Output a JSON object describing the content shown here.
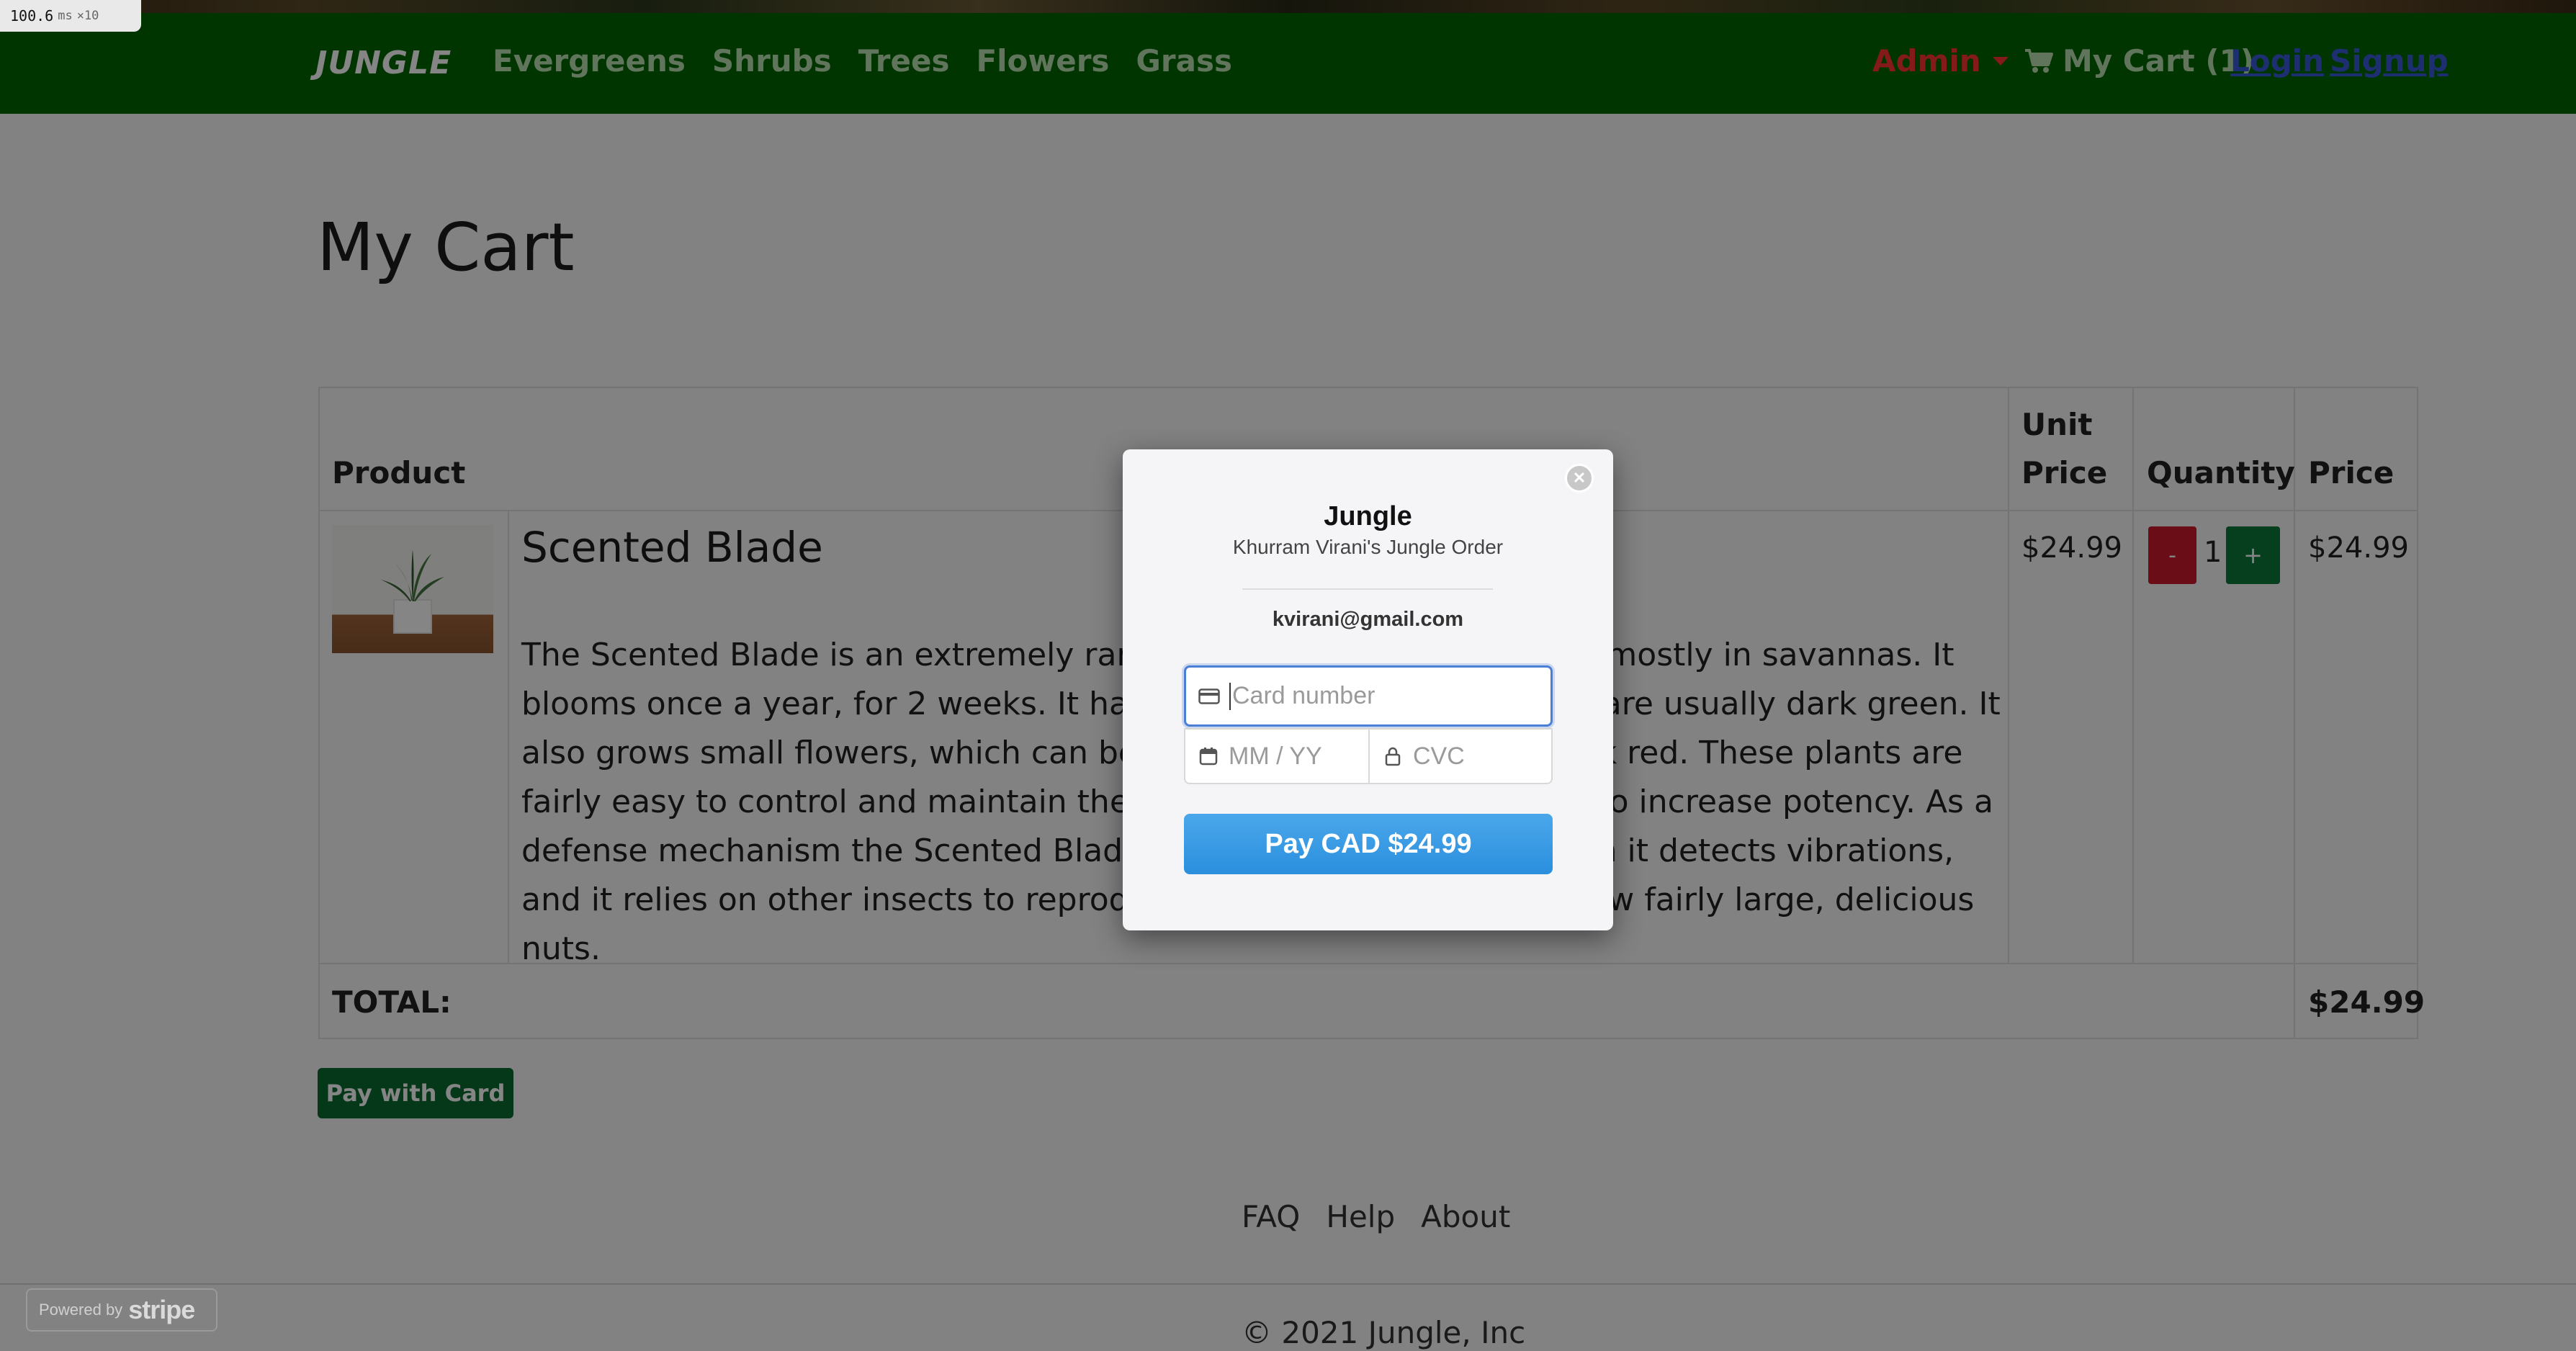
{
  "perf_overlay": {
    "value": "100.6",
    "unit": "ms",
    "multiplier": "×10"
  },
  "navbar": {
    "brand": "JUNGLE",
    "links": [
      "Evergreens",
      "Shrubs",
      "Trees",
      "Flowers",
      "Grass"
    ],
    "admin_label": "Admin",
    "cart_label": "My Cart (1)",
    "login_label": "Login",
    "signup_label": "Signup"
  },
  "page": {
    "title": "My Cart"
  },
  "cart_table": {
    "headers": {
      "product": "Product",
      "unit_price_line1": "Unit",
      "unit_price_line2": "Price",
      "quantity": "Quantity",
      "price": "Price"
    },
    "items": [
      {
        "name": "Scented Blade",
        "description": "The Scented Blade is an extremely rare, tall plant and can be found mostly in savannas. It blooms once a year, for 2 weeks. It has thin, palmate leaves, which are usually dark green. It also grows small flowers, which can be dark blue, light gold and dark red. These plants are fairly easy to control and maintain their growth. They can be eaten to increase potency. As a defense mechanism the Scented Blade can collapse its flowers when it detects vibrations, and it relies on other insects to reproduce. Once pollinated, they grow fairly large, delicious nuts.",
        "unit_price": "$24.99",
        "quantity": "1",
        "minus_label": "-",
        "plus_label": "+",
        "price": "$24.99"
      }
    ],
    "total_label": "TOTAL:",
    "total_value": "$24.99"
  },
  "pay_with_card_label": "Pay with Card",
  "footer": {
    "links": [
      "FAQ",
      "Help",
      "About"
    ],
    "copyright": "© 2021 Jungle, Inc"
  },
  "stripe_badge": {
    "prefix": "Powered by",
    "brand": "stripe"
  },
  "checkout_modal": {
    "title": "Jungle",
    "subtitle": "Khurram Virani's Jungle Order",
    "email": "kvirani@gmail.com",
    "card_number_placeholder": "Card number",
    "expiry_placeholder": "MM / YY",
    "cvc_placeholder": "CVC",
    "pay_button_label": "Pay CAD $24.99",
    "close_glyph": "✕"
  },
  "colors": {
    "navbar": "#006600",
    "admin": "#ff3333",
    "pay_button": "#2b8fde",
    "minus": "#cc1a2c",
    "plus": "#0a7a3a"
  }
}
